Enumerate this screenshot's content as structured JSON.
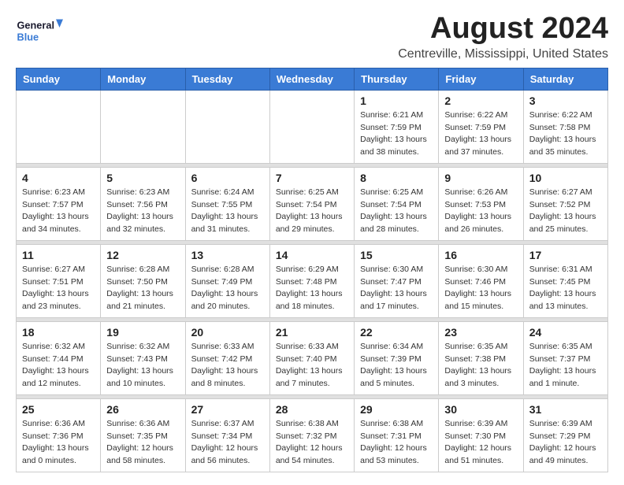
{
  "header": {
    "logo_line1": "General",
    "logo_line2": "Blue",
    "month_title": "August 2024",
    "location": "Centreville, Mississippi, United States"
  },
  "weekdays": [
    "Sunday",
    "Monday",
    "Tuesday",
    "Wednesday",
    "Thursday",
    "Friday",
    "Saturday"
  ],
  "weeks": [
    [
      {
        "day": "",
        "sunrise": "",
        "sunset": "",
        "daylight": "",
        "empty": true
      },
      {
        "day": "",
        "sunrise": "",
        "sunset": "",
        "daylight": "",
        "empty": true
      },
      {
        "day": "",
        "sunrise": "",
        "sunset": "",
        "daylight": "",
        "empty": true
      },
      {
        "day": "",
        "sunrise": "",
        "sunset": "",
        "daylight": "",
        "empty": true
      },
      {
        "day": "1",
        "sunrise": "Sunrise: 6:21 AM",
        "sunset": "Sunset: 7:59 PM",
        "daylight": "Daylight: 13 hours and 38 minutes.",
        "empty": false
      },
      {
        "day": "2",
        "sunrise": "Sunrise: 6:22 AM",
        "sunset": "Sunset: 7:59 PM",
        "daylight": "Daylight: 13 hours and 37 minutes.",
        "empty": false
      },
      {
        "day": "3",
        "sunrise": "Sunrise: 6:22 AM",
        "sunset": "Sunset: 7:58 PM",
        "daylight": "Daylight: 13 hours and 35 minutes.",
        "empty": false
      }
    ],
    [
      {
        "day": "4",
        "sunrise": "Sunrise: 6:23 AM",
        "sunset": "Sunset: 7:57 PM",
        "daylight": "Daylight: 13 hours and 34 minutes.",
        "empty": false
      },
      {
        "day": "5",
        "sunrise": "Sunrise: 6:23 AM",
        "sunset": "Sunset: 7:56 PM",
        "daylight": "Daylight: 13 hours and 32 minutes.",
        "empty": false
      },
      {
        "day": "6",
        "sunrise": "Sunrise: 6:24 AM",
        "sunset": "Sunset: 7:55 PM",
        "daylight": "Daylight: 13 hours and 31 minutes.",
        "empty": false
      },
      {
        "day": "7",
        "sunrise": "Sunrise: 6:25 AM",
        "sunset": "Sunset: 7:54 PM",
        "daylight": "Daylight: 13 hours and 29 minutes.",
        "empty": false
      },
      {
        "day": "8",
        "sunrise": "Sunrise: 6:25 AM",
        "sunset": "Sunset: 7:54 PM",
        "daylight": "Daylight: 13 hours and 28 minutes.",
        "empty": false
      },
      {
        "day": "9",
        "sunrise": "Sunrise: 6:26 AM",
        "sunset": "Sunset: 7:53 PM",
        "daylight": "Daylight: 13 hours and 26 minutes.",
        "empty": false
      },
      {
        "day": "10",
        "sunrise": "Sunrise: 6:27 AM",
        "sunset": "Sunset: 7:52 PM",
        "daylight": "Daylight: 13 hours and 25 minutes.",
        "empty": false
      }
    ],
    [
      {
        "day": "11",
        "sunrise": "Sunrise: 6:27 AM",
        "sunset": "Sunset: 7:51 PM",
        "daylight": "Daylight: 13 hours and 23 minutes.",
        "empty": false
      },
      {
        "day": "12",
        "sunrise": "Sunrise: 6:28 AM",
        "sunset": "Sunset: 7:50 PM",
        "daylight": "Daylight: 13 hours and 21 minutes.",
        "empty": false
      },
      {
        "day": "13",
        "sunrise": "Sunrise: 6:28 AM",
        "sunset": "Sunset: 7:49 PM",
        "daylight": "Daylight: 13 hours and 20 minutes.",
        "empty": false
      },
      {
        "day": "14",
        "sunrise": "Sunrise: 6:29 AM",
        "sunset": "Sunset: 7:48 PM",
        "daylight": "Daylight: 13 hours and 18 minutes.",
        "empty": false
      },
      {
        "day": "15",
        "sunrise": "Sunrise: 6:30 AM",
        "sunset": "Sunset: 7:47 PM",
        "daylight": "Daylight: 13 hours and 17 minutes.",
        "empty": false
      },
      {
        "day": "16",
        "sunrise": "Sunrise: 6:30 AM",
        "sunset": "Sunset: 7:46 PM",
        "daylight": "Daylight: 13 hours and 15 minutes.",
        "empty": false
      },
      {
        "day": "17",
        "sunrise": "Sunrise: 6:31 AM",
        "sunset": "Sunset: 7:45 PM",
        "daylight": "Daylight: 13 hours and 13 minutes.",
        "empty": false
      }
    ],
    [
      {
        "day": "18",
        "sunrise": "Sunrise: 6:32 AM",
        "sunset": "Sunset: 7:44 PM",
        "daylight": "Daylight: 13 hours and 12 minutes.",
        "empty": false
      },
      {
        "day": "19",
        "sunrise": "Sunrise: 6:32 AM",
        "sunset": "Sunset: 7:43 PM",
        "daylight": "Daylight: 13 hours and 10 minutes.",
        "empty": false
      },
      {
        "day": "20",
        "sunrise": "Sunrise: 6:33 AM",
        "sunset": "Sunset: 7:42 PM",
        "daylight": "Daylight: 13 hours and 8 minutes.",
        "empty": false
      },
      {
        "day": "21",
        "sunrise": "Sunrise: 6:33 AM",
        "sunset": "Sunset: 7:40 PM",
        "daylight": "Daylight: 13 hours and 7 minutes.",
        "empty": false
      },
      {
        "day": "22",
        "sunrise": "Sunrise: 6:34 AM",
        "sunset": "Sunset: 7:39 PM",
        "daylight": "Daylight: 13 hours and 5 minutes.",
        "empty": false
      },
      {
        "day": "23",
        "sunrise": "Sunrise: 6:35 AM",
        "sunset": "Sunset: 7:38 PM",
        "daylight": "Daylight: 13 hours and 3 minutes.",
        "empty": false
      },
      {
        "day": "24",
        "sunrise": "Sunrise: 6:35 AM",
        "sunset": "Sunset: 7:37 PM",
        "daylight": "Daylight: 13 hours and 1 minute.",
        "empty": false
      }
    ],
    [
      {
        "day": "25",
        "sunrise": "Sunrise: 6:36 AM",
        "sunset": "Sunset: 7:36 PM",
        "daylight": "Daylight: 13 hours and 0 minutes.",
        "empty": false
      },
      {
        "day": "26",
        "sunrise": "Sunrise: 6:36 AM",
        "sunset": "Sunset: 7:35 PM",
        "daylight": "Daylight: 12 hours and 58 minutes.",
        "empty": false
      },
      {
        "day": "27",
        "sunrise": "Sunrise: 6:37 AM",
        "sunset": "Sunset: 7:34 PM",
        "daylight": "Daylight: 12 hours and 56 minutes.",
        "empty": false
      },
      {
        "day": "28",
        "sunrise": "Sunrise: 6:38 AM",
        "sunset": "Sunset: 7:32 PM",
        "daylight": "Daylight: 12 hours and 54 minutes.",
        "empty": false
      },
      {
        "day": "29",
        "sunrise": "Sunrise: 6:38 AM",
        "sunset": "Sunset: 7:31 PM",
        "daylight": "Daylight: 12 hours and 53 minutes.",
        "empty": false
      },
      {
        "day": "30",
        "sunrise": "Sunrise: 6:39 AM",
        "sunset": "Sunset: 7:30 PM",
        "daylight": "Daylight: 12 hours and 51 minutes.",
        "empty": false
      },
      {
        "day": "31",
        "sunrise": "Sunrise: 6:39 AM",
        "sunset": "Sunset: 7:29 PM",
        "daylight": "Daylight: 12 hours and 49 minutes.",
        "empty": false
      }
    ]
  ]
}
